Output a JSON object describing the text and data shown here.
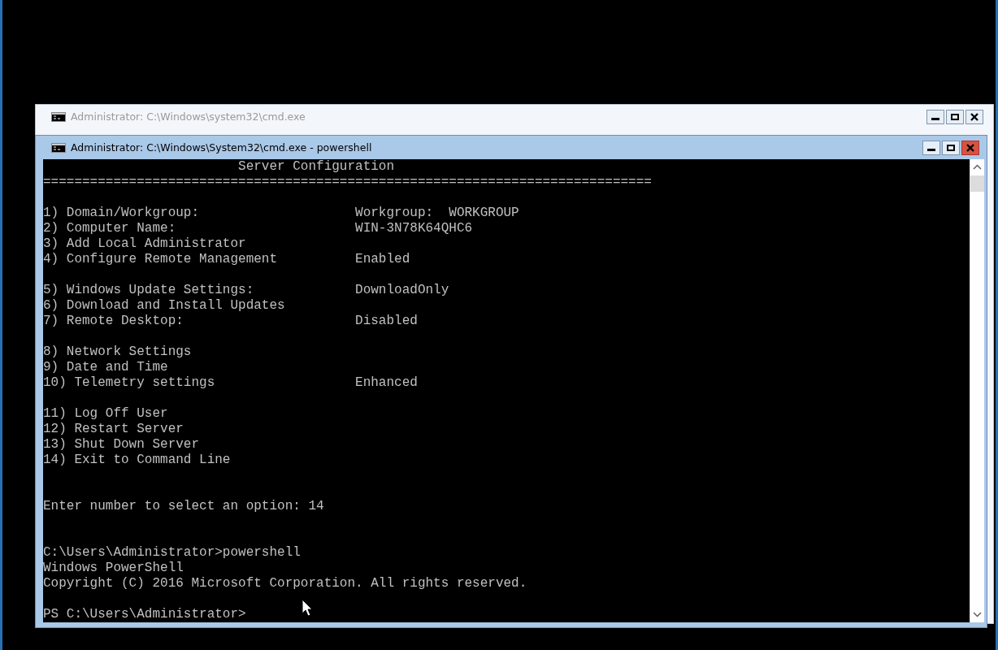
{
  "windows": [
    {
      "title": "Administrator: C:\\Windows\\system32\\cmd.exe",
      "active": false
    },
    {
      "title": "Administrator: C:\\Windows\\System32\\cmd.exe - powershell",
      "active": true
    }
  ],
  "console": {
    "heading": "Server Configuration",
    "rule": "==============================================================================",
    "menu_groups": [
      [
        {
          "label": "1) Domain/Workgroup:",
          "value": "Workgroup:  WORKGROUP"
        },
        {
          "label": "2) Computer Name:",
          "value": "WIN-3N78K64QHC6"
        },
        {
          "label": "3) Add Local Administrator"
        },
        {
          "label": "4) Configure Remote Management",
          "value": "Enabled"
        }
      ],
      [
        {
          "label": "5) Windows Update Settings:",
          "value": "DownloadOnly"
        },
        {
          "label": "6) Download and Install Updates"
        },
        {
          "label": "7) Remote Desktop:",
          "value": "Disabled"
        }
      ],
      [
        {
          "label": "8) Network Settings"
        },
        {
          "label": "9) Date and Time"
        },
        {
          "label": "10) Telemetry settings",
          "value": "Enhanced"
        }
      ],
      [
        {
          "label": "11) Log Off User"
        },
        {
          "label": "12) Restart Server"
        },
        {
          "label": "13) Shut Down Server"
        },
        {
          "label": "14) Exit to Command Line"
        }
      ]
    ],
    "prompt": "Enter number to select an option: 14",
    "command": "C:\\Users\\Administrator>powershell",
    "output": [
      "Windows PowerShell",
      "Copyright (C) 2016 Microsoft Corporation. All rights reserved."
    ],
    "ps_prompt": "PS C:\\Users\\Administrator>"
  }
}
